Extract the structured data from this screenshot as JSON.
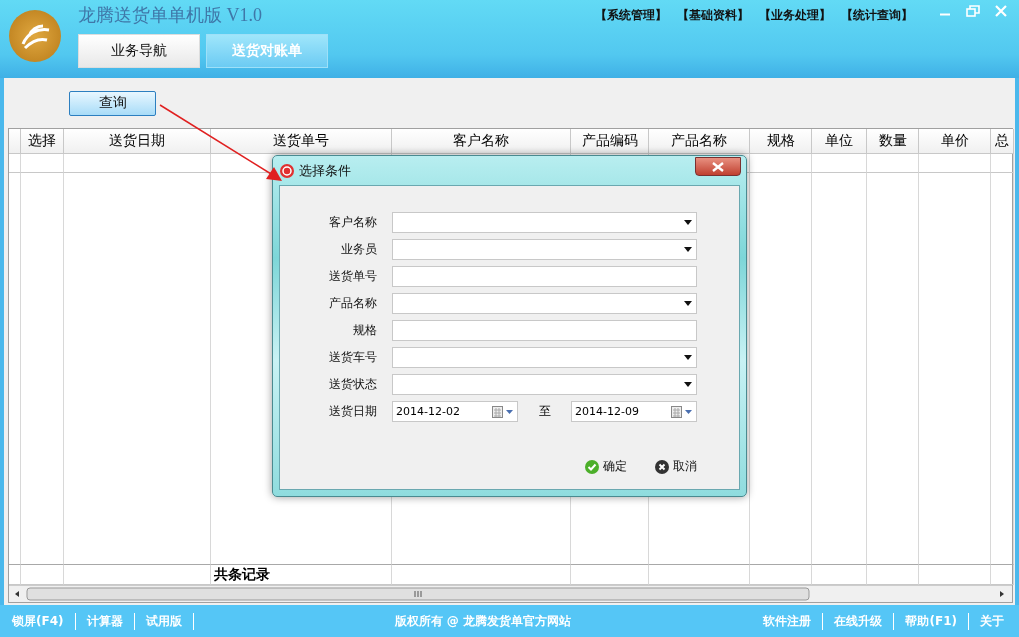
{
  "window": {
    "title": "龙腾送货单单机版 V1.0"
  },
  "menu": [
    "【系统管理】",
    "【基础资料】",
    "【业务处理】",
    "【统计查询】"
  ],
  "tabs": [
    {
      "label": "业务导航",
      "selected": false
    },
    {
      "label": "送货对账单",
      "selected": true
    }
  ],
  "query_button": "查询",
  "table": {
    "columns": [
      "选择",
      "送货日期",
      "送货单号",
      "客户名称",
      "产品编码",
      "产品名称",
      "规格",
      "单位",
      "数量",
      "单价",
      "总"
    ],
    "footer": {
      "text": "共条记录"
    }
  },
  "dialog": {
    "title": "选择条件",
    "fields": [
      {
        "label": "客户名称",
        "kind": "combo"
      },
      {
        "label": "业务员",
        "kind": "combo"
      },
      {
        "label": "送货单号",
        "kind": "text"
      },
      {
        "label": "产品名称",
        "kind": "combo"
      },
      {
        "label": "规格",
        "kind": "text"
      },
      {
        "label": "送货车号",
        "kind": "combo"
      },
      {
        "label": "送货状态",
        "kind": "combo"
      }
    ],
    "date_range": {
      "label": "送货日期",
      "from": "2014-12-02",
      "separator": "至",
      "to": "2014-12-09"
    },
    "buttons": [
      {
        "label": "确定",
        "kind": "ok"
      },
      {
        "label": "取消",
        "kind": "cancel"
      }
    ]
  },
  "status_bar": {
    "left": [
      "锁屏(F4)",
      "计算器",
      "试用版"
    ],
    "center": "版权所有 @ 龙腾发货单官方网站",
    "right": [
      "软件注册",
      "在线升级",
      "帮助(F1)",
      "关于"
    ]
  }
}
